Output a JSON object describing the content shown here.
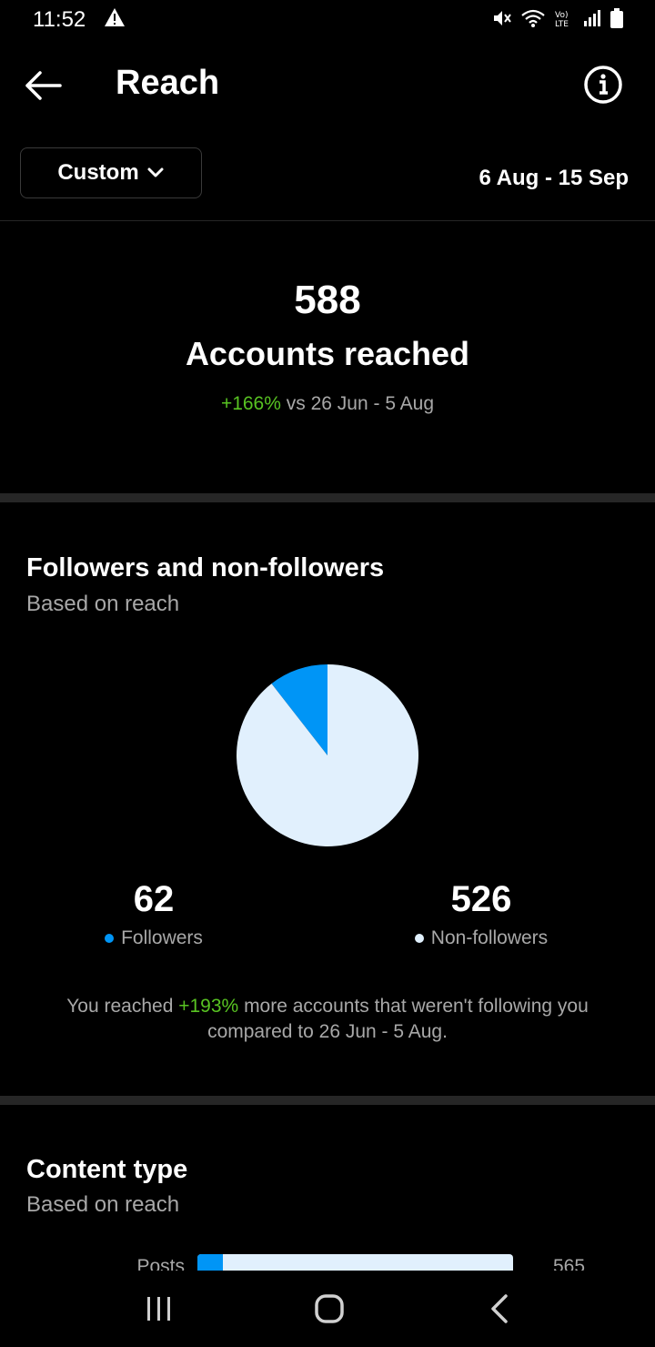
{
  "status_bar": {
    "time": "11:52"
  },
  "header": {
    "title": "Reach"
  },
  "filter": {
    "range_label": "Custom",
    "date_range": "6 Aug - 15 Sep"
  },
  "summary": {
    "value": "588",
    "label": "Accounts reached",
    "change": "+166%",
    "compare_text": "vs 26 Jun - 5 Aug"
  },
  "followers_section": {
    "title": "Followers and non-followers",
    "subtitle": "Based on reach",
    "followers": {
      "value": "62",
      "label": "Followers",
      "color": "#0095f6"
    },
    "non_followers": {
      "value": "526",
      "label": "Non-followers",
      "color": "#e1f0fd"
    },
    "note_prefix": "You reached",
    "note_change": "+193%",
    "note_suffix": "more accounts that weren't following you compared to 26 Jun - 5 Aug."
  },
  "content_type": {
    "title": "Content type",
    "subtitle": "Based on reach",
    "rows": [
      {
        "label": "Posts",
        "value": "565",
        "fraction": 0.08
      }
    ]
  },
  "chart_data": {
    "type": "pie",
    "slices": [
      {
        "name": "Followers",
        "value": 62,
        "color": "#0095f6"
      },
      {
        "name": "Non-followers",
        "value": 526,
        "color": "#e1f0fd"
      }
    ]
  },
  "icons": {
    "back": "arrow-left-icon",
    "info": "info-icon",
    "dropdown": "chevron-down-icon",
    "nav_recent": "recent-apps-icon",
    "nav_home": "home-icon",
    "nav_back": "nav-back-icon"
  }
}
